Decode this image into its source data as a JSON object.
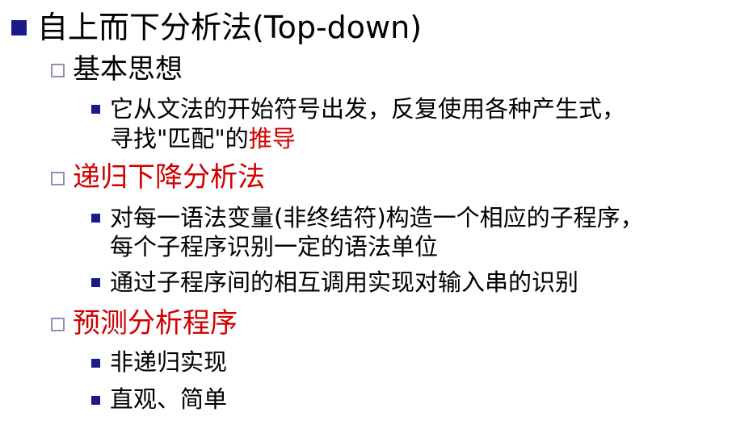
{
  "title": {
    "text": "自上而下分析法(Top-down)"
  },
  "sections": [
    {
      "heading": "基本思想",
      "heading_color": "#000000",
      "items": [
        {
          "line1": "它从文法的开始符号出发，反复使用各种产生式，",
          "line2_plain": "寻找\"匹配\"的",
          "line2_highlight": "推导"
        }
      ]
    },
    {
      "heading": "递归下降分析法",
      "heading_color": "#d00000",
      "items": [
        {
          "line1": "对每一语法变量(非终结符)构造一个相应的子程序，",
          "line2": "每个子程序识别一定的语法单位"
        },
        {
          "line1": "通过子程序间的相互调用实现对输入串的识别"
        }
      ]
    },
    {
      "heading": "预测分析程序",
      "heading_color": "#d00000",
      "items": [
        {
          "line1": "非递归实现"
        },
        {
          "line1": "直观、简单"
        }
      ]
    }
  ],
  "colors": {
    "bullet_fill": "#1a1a8c",
    "bullet_outline": "#8f8fb8",
    "highlight": "#d00000"
  }
}
